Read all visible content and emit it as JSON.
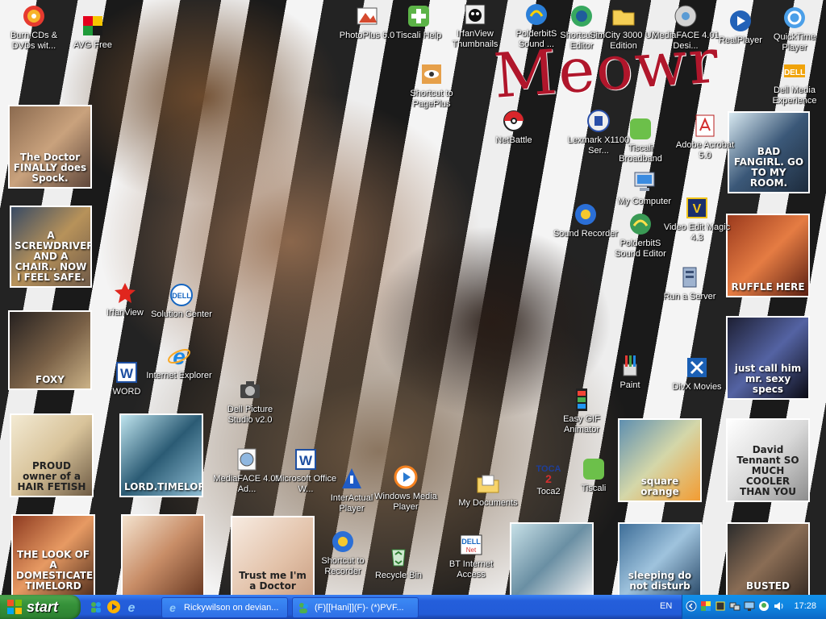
{
  "wallpaper": {
    "title": "Meowr"
  },
  "desktop_icons": [
    {
      "label": "Burn CDs & DVDs wit...",
      "icon": "burn-cd-icon"
    },
    {
      "label": "AVG Free",
      "icon": "avg-icon"
    },
    {
      "label": "PhotoPlus 6.0",
      "icon": "photoplus-icon"
    },
    {
      "label": "Tiscali Help",
      "icon": "tiscali-help-icon"
    },
    {
      "label": "IrfanView Thumbnails",
      "icon": "irfanview-thumbnails-icon"
    },
    {
      "label": "PolderbitS Sound ...",
      "icon": "polderbits-icon"
    },
    {
      "label": "Shortcut to Editor",
      "icon": "editor-icon"
    },
    {
      "label": "SimCity 3000 UK Edition",
      "icon": "folder-icon"
    },
    {
      "label": "MediaFACE 4.01 Desi...",
      "icon": "mediaface-icon"
    },
    {
      "label": "RealPlayer",
      "icon": "realplayer-icon"
    },
    {
      "label": "QuickTime Player",
      "icon": "quicktime-icon"
    },
    {
      "label": "Dell Media Experience",
      "icon": "dell-icon"
    },
    {
      "label": "Shortcut to PagePlus",
      "icon": "pageplus-icon"
    },
    {
      "label": "NetBattle",
      "icon": "netbattle-icon"
    },
    {
      "label": "Lexmark X1100 Ser...",
      "icon": "lexmark-icon"
    },
    {
      "label": "Tiscali Broadband",
      "icon": "tiscali-icon"
    },
    {
      "label": "Adobe Acrobat 5.0",
      "icon": "acrobat-icon"
    },
    {
      "label": "My Computer",
      "icon": "computer-icon"
    },
    {
      "label": "Sound Recorder",
      "icon": "sound-recorder-icon"
    },
    {
      "label": "PolderbitS Sound Editor",
      "icon": "polderbits-editor-icon"
    },
    {
      "label": "Video Edit Magic 4.3",
      "icon": "video-edit-icon"
    },
    {
      "label": "Run a Server",
      "icon": "server-icon"
    },
    {
      "label": "IrfanView",
      "icon": "irfanview-icon"
    },
    {
      "label": "Solution Center",
      "icon": "dell-solution-icon"
    },
    {
      "label": "WORD",
      "icon": "word-icon"
    },
    {
      "label": "Internet Explorer",
      "icon": "ie-icon"
    },
    {
      "label": "Dell Picture Studio v2.0",
      "icon": "picture-studio-icon"
    },
    {
      "label": "Paint",
      "icon": "paint-icon"
    },
    {
      "label": "DivX Movies",
      "icon": "divx-icon"
    },
    {
      "label": "Easy GIF Animator",
      "icon": "gif-animator-icon"
    },
    {
      "label": "MediaFACE 4.01 Ad...",
      "icon": "mediaface-ad-icon"
    },
    {
      "label": "Microsoft Office W...",
      "icon": "office-word-icon"
    },
    {
      "label": "InterActual Player",
      "icon": "interactual-icon"
    },
    {
      "label": "Windows Media Player",
      "icon": "wmp-icon"
    },
    {
      "label": "My Documents",
      "icon": "documents-icon"
    },
    {
      "label": "Toca2",
      "icon": "toca2-icon"
    },
    {
      "label": "Tiscali",
      "icon": "tiscali2-icon"
    },
    {
      "label": "Shortcut to Recorder",
      "icon": "recorder-icon"
    },
    {
      "label": "Recycle Bin",
      "icon": "recycle-bin-icon"
    },
    {
      "label": "BT Internet Access",
      "icon": "bt-icon"
    }
  ],
  "thumbnails": [
    {
      "caption": "The Doctor FINALLY does Spock."
    },
    {
      "caption": "A SCREWDRIVER AND A CHAIR.. NOW I FEEL SAFE."
    },
    {
      "caption": "FOXY"
    },
    {
      "caption": "PROUD owner of a HAIR FETISH"
    },
    {
      "caption": "LORD.TIMELORD."
    },
    {
      "caption": "THE LOOK OF A DOMESTICATED TIMELORD"
    },
    {
      "caption": ""
    },
    {
      "caption": "Trust me I'm a Doctor"
    },
    {
      "caption": ""
    },
    {
      "caption": "sleeping do not disturb"
    },
    {
      "caption": "BUSTED"
    },
    {
      "caption": "square orange"
    },
    {
      "caption": "David Tennant SO MUCH COOLER THAN YOU"
    },
    {
      "caption": "just call him mr. sexy specs"
    },
    {
      "caption": "RUFFLE HERE"
    },
    {
      "caption": "BAD FANGIRL. GO TO MY ROOM."
    }
  ],
  "taskbar": {
    "start_label": "start",
    "tasks": [
      {
        "label": "Rickywilson on devian...",
        "icon": "ie-icon"
      },
      {
        "label": "(F)[[Hani]](F)- (*)PVF...",
        "icon": "messenger-icon"
      }
    ],
    "language": "EN",
    "clock": "17:28"
  },
  "colors": {
    "taskbar": "#245edb",
    "start_green": "#36923a",
    "title_red": "#b0162b"
  }
}
